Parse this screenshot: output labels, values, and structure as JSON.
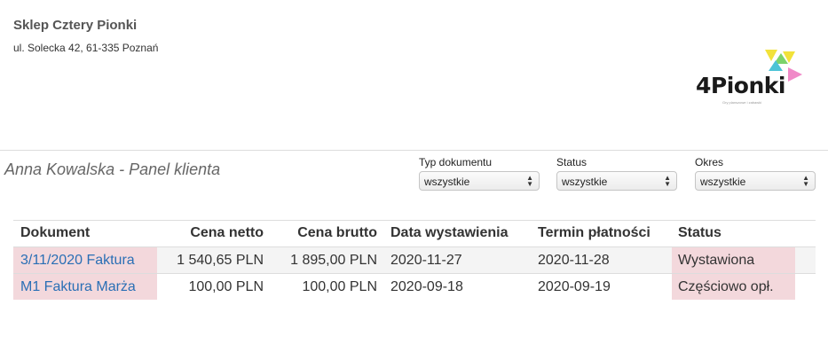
{
  "shop": {
    "name": "Sklep Cztery Pionki",
    "address": "ul. Solecka 42, 61-335 Poznań"
  },
  "logo": {
    "text": "4Pionki",
    "tagline": "Gry planszowe i zabawki",
    "colors": {
      "yellow": "#f2e23a",
      "green": "#7cd36b",
      "teal": "#4cc3d6",
      "pink": "#f08ac8"
    }
  },
  "panel": {
    "title": "Anna Kowalska - Panel klienta"
  },
  "filters": {
    "doc_type": {
      "label": "Typ dokumentu",
      "value": "wszystkie"
    },
    "status": {
      "label": "Status",
      "value": "wszystkie"
    },
    "period": {
      "label": "Okres",
      "value": "wszystkie"
    }
  },
  "table": {
    "headers": {
      "document": "Dokument",
      "net_price": "Cena netto",
      "gross_price": "Cena brutto",
      "issue_date": "Data wystawienia",
      "due_date": "Termin płatności",
      "status": "Status"
    },
    "rows": [
      {
        "document": "3/11/2020 Faktura",
        "net_price": "1 540,65 PLN",
        "gross_price": "1 895,00 PLN",
        "issue_date": "2020-11-27",
        "due_date": "2020-11-28",
        "status": "Wystawiona"
      },
      {
        "document": "M1 Faktura Marża",
        "net_price": "100,00 PLN",
        "gross_price": "100,00 PLN",
        "issue_date": "2020-09-18",
        "due_date": "2020-09-19",
        "status": "Częściowo opł."
      }
    ]
  },
  "colors": {
    "link": "#2a6fb5",
    "highlight": "#f3d8dc",
    "stripe": "#f4f4f4"
  }
}
